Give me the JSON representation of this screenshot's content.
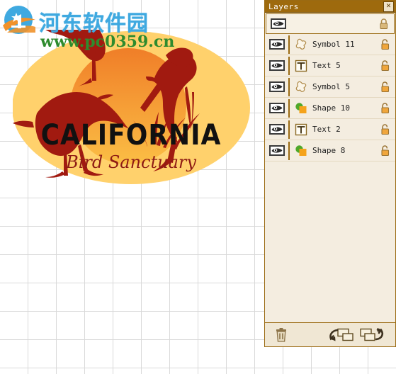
{
  "app": {
    "canvas": {
      "grid_visible": true,
      "grid_size_px": 40,
      "background": "#ffffff"
    }
  },
  "watermark": {
    "logo_icon": "site-logo-icon",
    "site_name": "河东软件园",
    "site_url": "www.pc0359.cn",
    "site_name_color": "#3FA9E0",
    "site_url_color": "#2E8B2E"
  },
  "artwork": {
    "title_text": "CALIFORNIA",
    "subtitle_text": "Bird Sanctuary",
    "ellipse_color": "#FFD16C",
    "sun_color_top": "#F07E28",
    "sun_color_bottom": "#FBB03B",
    "bird_color": "#A11A10",
    "title_color": "#111111",
    "subtitle_color": "#8E1B14"
  },
  "layers_panel": {
    "title": "Layers",
    "close_label": "✕",
    "close_icon": "close-icon",
    "header_row": {
      "visibility_icon": "eye-icon",
      "lock_icon": "lock-closed-icon",
      "name": ""
    },
    "rows": [
      {
        "name": "Symbol 11",
        "type": "symbol",
        "type_icon": "symbol-blob-icon",
        "visibility_icon": "eye-icon",
        "lock_icon": "lock-open-icon"
      },
      {
        "name": "Text 5",
        "type": "text",
        "type_icon": "text-t-icon",
        "visibility_icon": "eye-icon",
        "lock_icon": "lock-open-icon"
      },
      {
        "name": "Symbol 5",
        "type": "symbol",
        "type_icon": "symbol-blob-icon",
        "visibility_icon": "eye-icon",
        "lock_icon": "lock-open-icon"
      },
      {
        "name": "Shape 10",
        "type": "shape",
        "type_icon": "shape-circle-square-icon",
        "visibility_icon": "eye-icon",
        "lock_icon": "lock-open-icon"
      },
      {
        "name": "Text 2",
        "type": "text",
        "type_icon": "text-t-icon",
        "visibility_icon": "eye-icon",
        "lock_icon": "lock-open-icon"
      },
      {
        "name": "Shape 8",
        "type": "shape",
        "type_icon": "shape-circle-square-icon",
        "visibility_icon": "eye-icon",
        "lock_icon": "lock-open-icon"
      }
    ],
    "toolbar": {
      "delete_icon": "trash-icon",
      "send_backward_icon": "send-backward-icon",
      "bring_forward_icon": "bring-forward-icon"
    },
    "colors": {
      "titlebar": "#9E6A0D",
      "panel_bg": "#F4EDE0",
      "border": "#9A6A12",
      "toolbar_bg": "#F0E7D4"
    }
  }
}
